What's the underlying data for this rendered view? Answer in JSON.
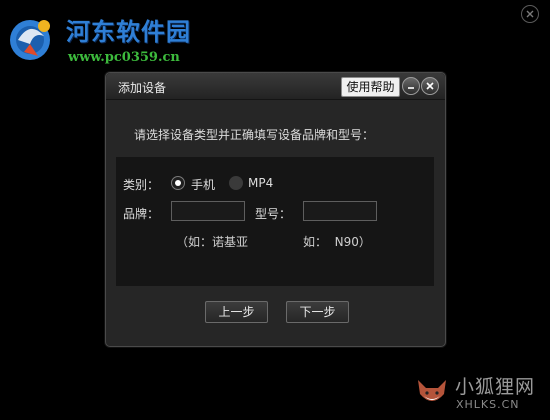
{
  "watermark_top": {
    "title": "河东软件园",
    "url": "www.pc0359.cn"
  },
  "watermark_bottom": {
    "title": "小狐狸网",
    "url": "XHLKS.CN"
  },
  "dialog": {
    "title": "添加设备",
    "help_label": "使用帮助",
    "prompt": "请选择设备类型并正确填写设备品牌和型号：",
    "category_label": "类别：",
    "options": [
      "手机",
      "MP4"
    ],
    "selected_option": "手机",
    "brand_label": "品牌：",
    "brand_value": "",
    "model_label": "型号：",
    "model_value": "",
    "brand_hint": "（如：诺基亚",
    "model_hint": "如：  N90）",
    "prev_label": "上一步",
    "next_label": "下一步"
  },
  "icons": [
    "close-icon",
    "minimize-icon",
    "logo-icon",
    "fox-icon"
  ],
  "colors": {
    "background": "#000000",
    "dialog_bg": "#262626",
    "panel_bg": "#151515",
    "watermark_blue": "#2f7fd6",
    "watermark_green": "#3dbb3d"
  }
}
